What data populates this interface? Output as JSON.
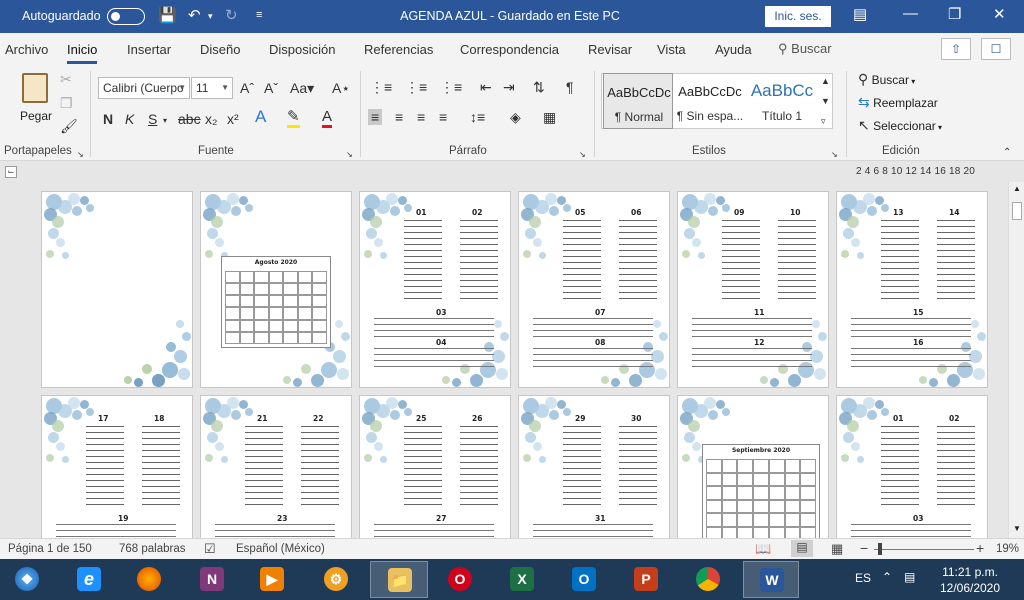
{
  "titlebar": {
    "autosave_label": "Autoguardado",
    "doc_title": "AGENDA AZUL  -  Guardado en Este PC",
    "signin_label": "Inic. ses.",
    "accent": "#2b579a"
  },
  "tabs": [
    "Archivo",
    "Inicio",
    "Insertar",
    "Diseño",
    "Disposición",
    "Referencias",
    "Correspondencia",
    "Revisar",
    "Vista",
    "Ayuda"
  ],
  "search_label": "Buscar",
  "ribbon": {
    "clipboard": {
      "paste_label": "Pegar",
      "group": "Portapapeles"
    },
    "font": {
      "name": "Calibri (Cuerpo",
      "size": "11",
      "group": "Fuente",
      "case_label": "Aa"
    },
    "paragraph": {
      "group": "Párrafo"
    },
    "styles": {
      "group": "Estilos",
      "items": [
        {
          "sample": "AaBbCcDc",
          "name": "¶ Normal"
        },
        {
          "sample": "AaBbCcDc",
          "name": "¶ Sin espa..."
        },
        {
          "sample": "AaBbCc",
          "name": "Título 1"
        }
      ]
    },
    "editing": {
      "group": "Edición",
      "find": "Buscar",
      "replace": "Reemplazar",
      "select": "Seleccionar"
    }
  },
  "ruler": {
    "numbers": "2  4  6  8  10  12  14  16  18  20"
  },
  "pages_row1": [
    {
      "type": "blank"
    },
    {
      "type": "calendar",
      "title": "Agosto 2020"
    },
    {
      "type": "days",
      "top": [
        "01",
        "02"
      ],
      "bottom": [
        "03",
        "04"
      ]
    },
    {
      "type": "days",
      "top": [
        "05",
        "06"
      ],
      "bottom": [
        "07",
        "08"
      ]
    },
    {
      "type": "days",
      "top": [
        "09",
        "10"
      ],
      "bottom": [
        "11",
        "12"
      ]
    },
    {
      "type": "days",
      "top": [
        "13",
        "14"
      ],
      "bottom": [
        "15",
        "16"
      ]
    }
  ],
  "pages_row2": [
    {
      "type": "days",
      "top": [
        "17",
        "18"
      ],
      "bottom": [
        "19"
      ]
    },
    {
      "type": "days",
      "top": [
        "21",
        "22"
      ],
      "bottom": [
        "23"
      ]
    },
    {
      "type": "days",
      "top": [
        "25",
        "26"
      ],
      "bottom": [
        "27"
      ]
    },
    {
      "type": "days",
      "top": [
        "29",
        "30"
      ],
      "bottom": [
        "31"
      ]
    },
    {
      "type": "calendar",
      "title": "Septiembre 2020"
    },
    {
      "type": "days",
      "top": [
        "01",
        "02"
      ],
      "bottom": [
        "03"
      ]
    }
  ],
  "statusbar": {
    "page": "Página 1 de 150",
    "words": "768 palabras",
    "language": "Español (México)",
    "zoom": "19%"
  },
  "taskbar": {
    "lang": "ES",
    "time": "11:21 p.m.",
    "date": "12/06/2020"
  }
}
